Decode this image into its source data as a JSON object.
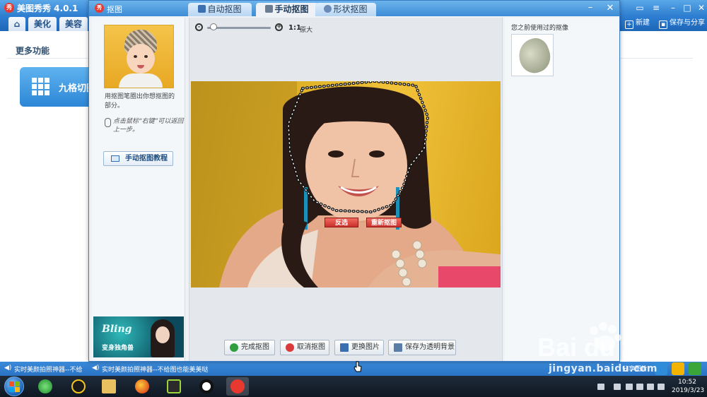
{
  "main_window": {
    "title": "美图秀秀 4.0.1",
    "tabs": [
      {
        "label": "⌂"
      },
      {
        "label": "美化"
      },
      {
        "label": "美容"
      }
    ],
    "right_buttons": {
      "new": "新建",
      "save_share": "保存与分享"
    },
    "more_functions": "更多功能",
    "grid_card_label": "九格切图",
    "status_left": "实时美颜拍照神器--不给",
    "status_right": "实时美颜拍照神器--不给图也能美美哒",
    "share_label": "分享图片"
  },
  "dialog": {
    "title": "抠图",
    "tabs": [
      {
        "label": "自动抠图"
      },
      {
        "label": "手动抠图"
      },
      {
        "label": "形状抠图"
      }
    ],
    "active_tab": "手动抠图",
    "left_panel": {
      "hint_text": "用抠图笔圈出你想抠图的部分。",
      "mouse_hint": "点击鼠标“右键”可以返回上一步。",
      "tutorial_button": "手动抠图教程",
      "ad_title": "Bling",
      "ad_subtitle": "变身独角兽"
    },
    "zoom": {
      "ratio": "1:1",
      "original": "原大",
      "level": 0.1
    },
    "overlay_buttons": {
      "invert": "反选",
      "redraw": "重新抠图"
    },
    "action_buttons": [
      {
        "label": "完成抠图",
        "icon": "check-icon",
        "color": "#2e9e3e"
      },
      {
        "label": "取消抠图",
        "icon": "cancel-icon",
        "color": "#d93a3a"
      },
      {
        "label": "更换图片",
        "icon": "image-icon",
        "color": "#3a6fb0"
      },
      {
        "label": "保存为透明背景",
        "icon": "save-icon",
        "color": "#5a7da8"
      }
    ],
    "right_panel": {
      "recent_label": "您之前使用过的抠像"
    }
  },
  "taskbar": {
    "time": "10:52",
    "date": "2019/3/23"
  },
  "watermark": {
    "text": "jingyan.baidu.com",
    "logo": "Bai du 经验"
  },
  "colors": {
    "accent": "#2f7fd0",
    "dialog_bg": "#eef2f6",
    "danger": "#c9302c",
    "photo_bg": "#e3b52a"
  }
}
